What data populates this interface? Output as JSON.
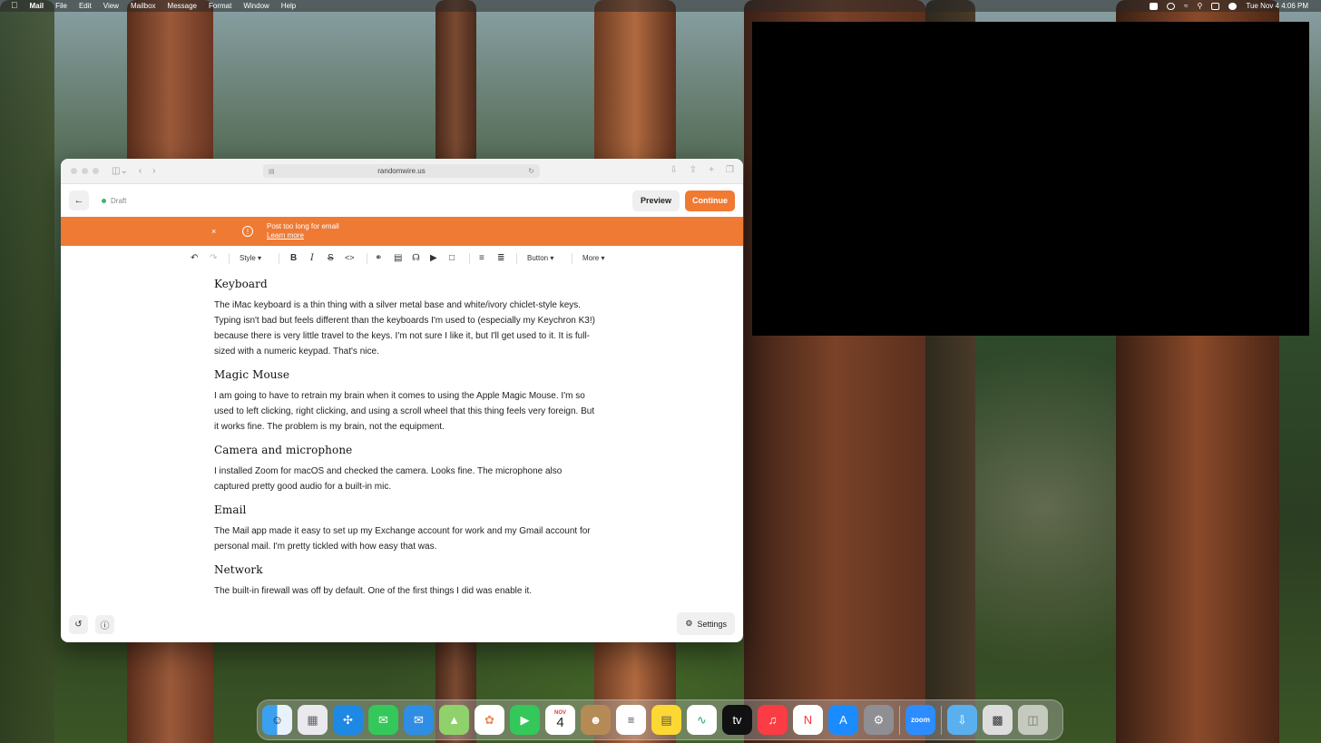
{
  "menubar": {
    "app": "Mail",
    "menus": [
      "File",
      "Edit",
      "View",
      "Mailbox",
      "Message",
      "Format",
      "Window",
      "Help"
    ],
    "clock": "Tue Nov 4  4:06 PM"
  },
  "browser": {
    "url": "randomwire.us"
  },
  "editor": {
    "status": "Draft",
    "preview_label": "Preview",
    "continue_label": "Continue",
    "banner": {
      "message": "Post too long for email",
      "link": "Learn more",
      "color": "#ee7a34"
    },
    "toolbar": {
      "style_label": "Style",
      "button_label": "Button",
      "more_label": "More"
    },
    "settings_label": "Settings"
  },
  "content": {
    "sections": [
      {
        "heading": "Keyboard",
        "body": "The iMac keyboard is a thin thing with a silver metal base and white/ivory chiclet-style keys. Typing isn't bad but feels different than the keyboards I'm used to (especially my Keychron K3!) because there is very little travel to the keys. I'm not sure I like it, but I'll get used to it. It is full-sized with a numeric keypad. That's nice."
      },
      {
        "heading": "Magic Mouse",
        "body": "I am going to have to retrain my brain when it comes to using the Apple Magic Mouse. I'm so used to left clicking, right clicking, and using a scroll wheel that this thing feels very foreign. But it works fine. The problem is my brain, not the equipment."
      },
      {
        "heading": "Camera and microphone",
        "body": "I installed Zoom for macOS and checked the camera. Looks fine. The microphone also captured pretty good audio for a built-in mic."
      },
      {
        "heading": "Email",
        "body": "The Mail app made it easy to set up my Exchange account for work and my Gmail account for personal mail. I'm pretty tickled with how easy that was."
      },
      {
        "heading": "Network",
        "body": "The built-in firewall was off by default. One of the first things I did was enable it."
      }
    ]
  },
  "dock": {
    "calendar_month": "NOV",
    "calendar_day": "4",
    "tv_label": "tv",
    "zoom_label": "zoom"
  }
}
